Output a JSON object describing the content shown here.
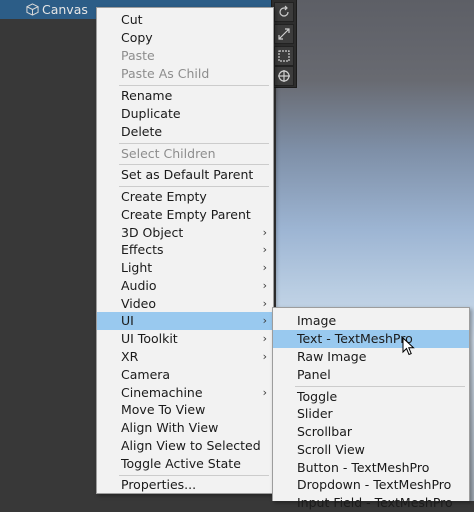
{
  "hierarchy": {
    "selected_item": "Canvas",
    "icon": "cube-icon"
  },
  "scene_toolbar": {
    "icons": [
      "rotate-tool-icon",
      "scale-tool-icon",
      "rect-tool-icon",
      "transform-tool-icon"
    ]
  },
  "context_menu": {
    "items": [
      {
        "label": "Cut"
      },
      {
        "label": "Copy"
      },
      {
        "label": "Paste",
        "disabled": true
      },
      {
        "label": "Paste As Child",
        "disabled": true
      },
      {
        "label": "Rename"
      },
      {
        "label": "Duplicate"
      },
      {
        "label": "Delete"
      },
      {
        "label": "Select Children",
        "disabled": true
      },
      {
        "label": "Set as Default Parent"
      },
      {
        "label": "Create Empty"
      },
      {
        "label": "Create Empty Parent"
      },
      {
        "label": "3D Object",
        "submenu": true
      },
      {
        "label": "Effects",
        "submenu": true
      },
      {
        "label": "Light",
        "submenu": true
      },
      {
        "label": "Audio",
        "submenu": true
      },
      {
        "label": "Video",
        "submenu": true
      },
      {
        "label": "UI",
        "submenu": true,
        "highlighted": true
      },
      {
        "label": "UI Toolkit",
        "submenu": true
      },
      {
        "label": "XR",
        "submenu": true
      },
      {
        "label": "Camera"
      },
      {
        "label": "Cinemachine",
        "submenu": true
      },
      {
        "label": "Move To View"
      },
      {
        "label": "Align With View"
      },
      {
        "label": "Align View to Selected"
      },
      {
        "label": "Toggle Active State"
      },
      {
        "label": "Properties..."
      }
    ],
    "arrow_glyph": "›"
  },
  "ui_submenu": {
    "items": [
      {
        "label": "Image"
      },
      {
        "label": "Text - TextMeshPro",
        "highlighted": true
      },
      {
        "label": "Raw Image"
      },
      {
        "label": "Panel"
      },
      {
        "label": "Toggle"
      },
      {
        "label": "Slider"
      },
      {
        "label": "Scrollbar"
      },
      {
        "label": "Scroll View"
      },
      {
        "label": "Button - TextMeshPro"
      },
      {
        "label": "Dropdown - TextMeshPro"
      },
      {
        "label": "Input Field - TextMeshPro"
      }
    ]
  },
  "colors": {
    "highlight": "#99c9ef",
    "selection": "#2c5d87",
    "menu_bg": "#f2f2f2"
  }
}
